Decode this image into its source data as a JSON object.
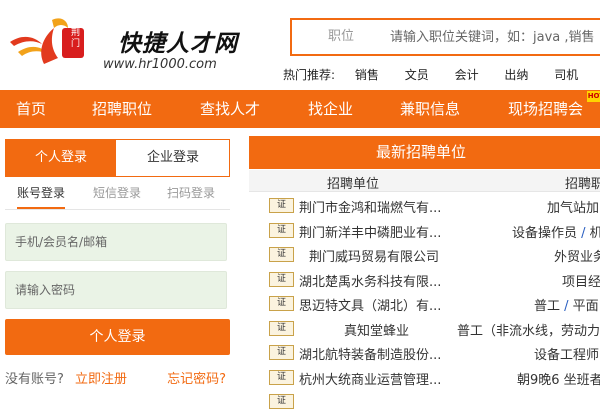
{
  "header": {
    "logo_badge": "荆门",
    "logo_title": "快捷人才网",
    "logo_url": "www.hr1000.com"
  },
  "search": {
    "category": "职位",
    "placeholder": "请输入职位关键词，如：java ,销售"
  },
  "hot": {
    "label": "热门推荐:",
    "items": [
      "销售",
      "文员",
      "会计",
      "出纳",
      "司机"
    ]
  },
  "nav": {
    "items": [
      "首页",
      "招聘职位",
      "查找人才",
      "找企业",
      "兼职信息",
      "现场招聘会"
    ],
    "badge": "HOT"
  },
  "login": {
    "tabs": [
      "个人登录",
      "企业登录"
    ],
    "sub_tabs": [
      "账号登录",
      "短信登录",
      "扫码登录"
    ],
    "username_placeholder": "手机/会员名/邮箱",
    "password_placeholder": "请输入密码",
    "submit": "个人登录",
    "no_account": "没有账号?",
    "register": "立即注册",
    "forgot": "忘记密码?"
  },
  "recruit": {
    "title": "最新招聘单位",
    "col_company": "招聘单位",
    "col_jobs": "招聘职",
    "cert_label": "证",
    "rows": [
      {
        "company": "荆门市金鸿和瑞燃气有...",
        "jobs": [
          "加气站加"
        ]
      },
      {
        "company": "荆门新洋丰中磷肥业有...",
        "jobs": [
          "设备操作员",
          "机"
        ]
      },
      {
        "company": "荆门威玛贸易有限公司",
        "jobs": [
          "外贸业务"
        ]
      },
      {
        "company": "湖北楚禹水务科技有限...",
        "jobs": [
          "项目经"
        ]
      },
      {
        "company": "思迈特文具（湖北）有...",
        "jobs": [
          "普工",
          "平面"
        ]
      },
      {
        "company": "真知堂蜂业",
        "jobs": [
          "普工（非流水线，劳动力"
        ]
      },
      {
        "company": "湖北航特装备制造股份...",
        "jobs": [
          "设备工程师"
        ]
      },
      {
        "company": "杭州大统商业运营管理...",
        "jobs": [
          "朝9晚6 坐班者"
        ]
      }
    ]
  },
  "colors": {
    "accent": "#f26a11",
    "field_bg": "#eaf3e6"
  }
}
